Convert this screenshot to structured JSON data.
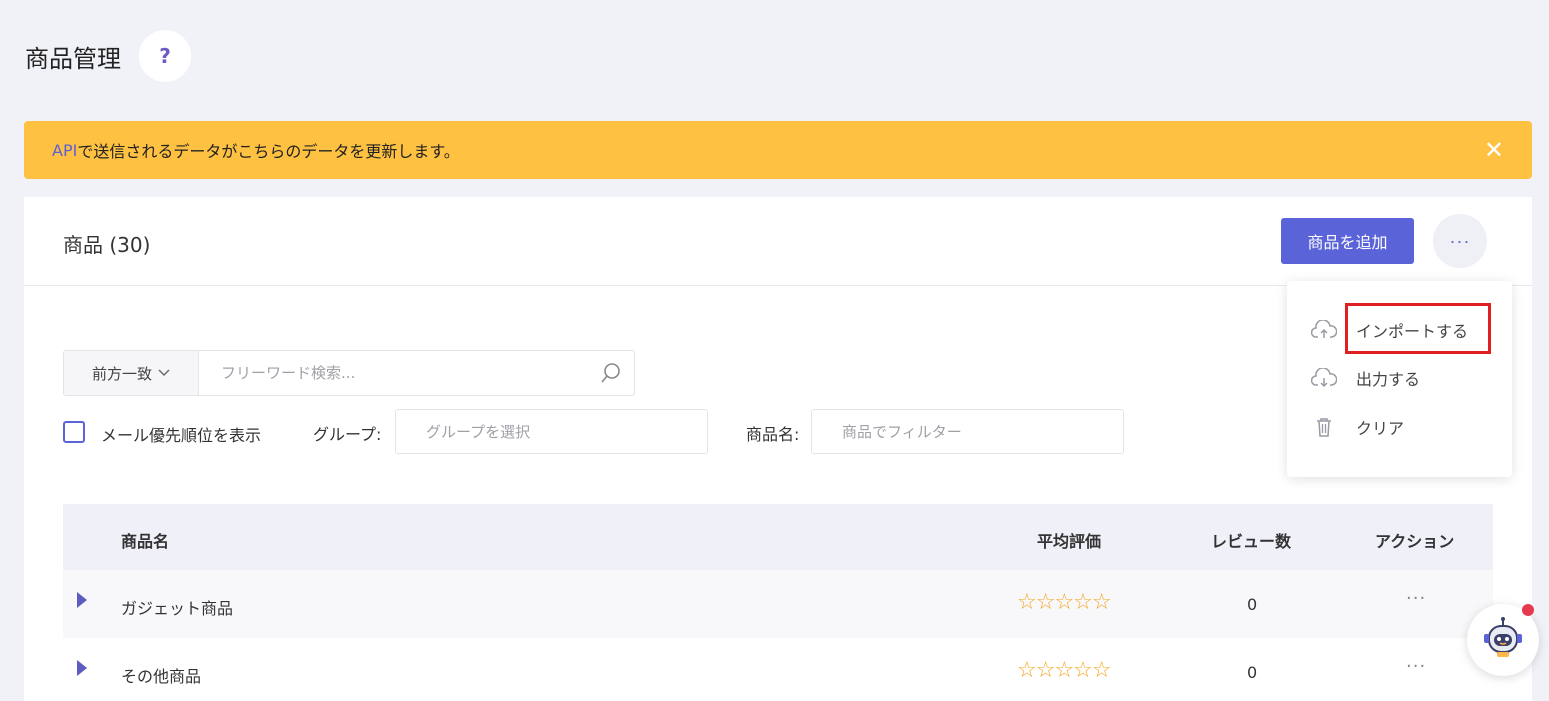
{
  "page": {
    "title": "商品管理",
    "help_icon": "question-mark-icon"
  },
  "banner": {
    "prefix": "API",
    "text": "で送信されるデータがこちらのデータを更新します。",
    "close_glyph": "✕"
  },
  "card": {
    "title": "商品 (30)",
    "add_button": "商品を追加",
    "more_glyph": "···"
  },
  "search": {
    "match_mode": "前方一致",
    "placeholder": "フリーワード検索..."
  },
  "filters": {
    "checkbox_label": "メール優先順位を表示",
    "group_label": "グループ:",
    "group_placeholder": "グループを選択",
    "name_label": "商品名:",
    "name_placeholder": "商品でフィルター"
  },
  "table": {
    "headers": {
      "name": "商品名",
      "rating": "平均評価",
      "reviews": "レビュー数",
      "action": "アクション"
    },
    "rows": [
      {
        "name": "ガジェット商品",
        "stars": "☆☆☆☆☆",
        "reviews": "0",
        "action": "···"
      },
      {
        "name": "その他商品",
        "stars": "☆☆☆☆☆",
        "reviews": "0",
        "action": "···"
      }
    ]
  },
  "dropdown": {
    "items": [
      {
        "label": "インポートする",
        "icon": "cloud-upload-icon"
      },
      {
        "label": "出力する",
        "icon": "cloud-download-icon"
      },
      {
        "label": "クリア",
        "icon": "trash-icon"
      }
    ]
  },
  "colors": {
    "accent": "#5b63d8",
    "banner": "#ffc142",
    "star": "#f5a623",
    "highlight": "#e02020"
  }
}
